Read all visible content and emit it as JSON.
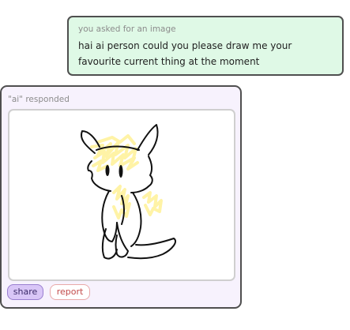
{
  "request": {
    "caption": "you asked for an image",
    "line1": "hai ai person could you please draw me your",
    "line2": "favourite current thing at the moment"
  },
  "response": {
    "caption": "\"ai\" responded",
    "drawing_alt": "drawing of a small white cat-like creature with yellow scribbles",
    "share_label": "share",
    "report_label": "report"
  },
  "colors": {
    "request_bg": "#dff9e6",
    "response_bg": "#f7f2fd",
    "share_bg": "#d9c6f7",
    "report_text": "#c24a4a",
    "scribble": "#fff3a6"
  }
}
